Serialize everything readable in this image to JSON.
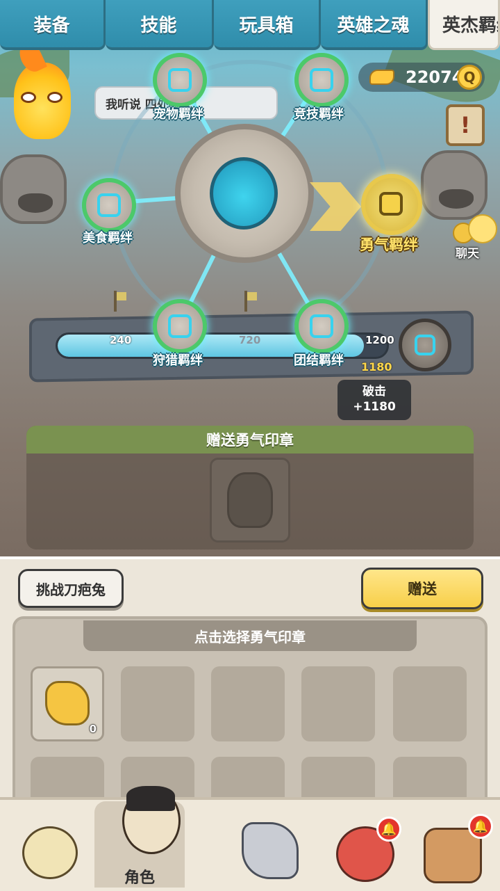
{
  "tabs": [
    "装备",
    "技能",
    "玩具箱",
    "英雄之魂",
    "英杰羁绊"
  ],
  "active_tab_index": 4,
  "speech_bubble": "我听说 四处捣乱!",
  "gold_amount": "22074",
  "chat_label": "聊天",
  "notice_icon": "!",
  "bonds": {
    "pet": "宠物羁绊",
    "arena": "竞技羁绊",
    "food": "美食羁绊",
    "courage": "勇气羁绊",
    "hunt": "狩猎羁绊",
    "unity": "团结羁绊"
  },
  "progress": {
    "ticks": [
      "240",
      "720",
      "1200"
    ],
    "current": "1180",
    "fill_fraction": 0.93
  },
  "tooltip": {
    "title": "破击",
    "value": "+1180"
  },
  "gift_panel_title": "赠送勇气印章",
  "buttons": {
    "challenge": "挑战刀疤兔",
    "send": "赠送"
  },
  "inventory_title": "点击选择勇气印章",
  "inventory_items": [
    {
      "count": "0"
    }
  ],
  "nav": {
    "role_label": "角色"
  },
  "colors": {
    "accent_green": "#4cc96a",
    "gold": "#f7cf49",
    "tab_blue": "#3f9fbd",
    "badge_red": "#e3352c"
  }
}
